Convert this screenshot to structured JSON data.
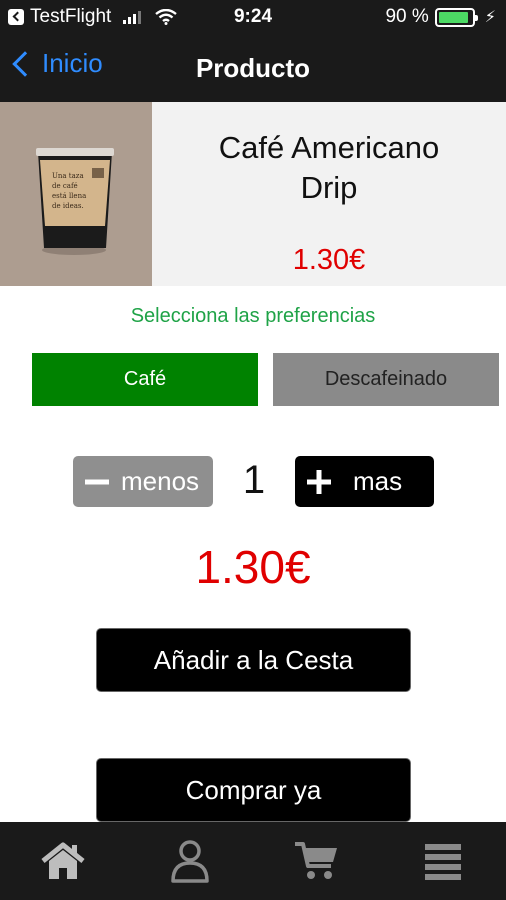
{
  "status_bar": {
    "app_name": "TestFlight",
    "time": "9:24",
    "battery_text": "90 %",
    "battery_level": 0.9,
    "battery_color": "#4cd964"
  },
  "nav": {
    "back_label": "Inicio",
    "title": "Producto"
  },
  "product": {
    "name_line1": "Café Americano",
    "name_line2": "Drip",
    "price": "1.30€",
    "image_icon": "coffee-cup-icon",
    "image_text": [
      "Una taza",
      "de café",
      "está llena",
      "de ideas."
    ]
  },
  "preferences": {
    "label": "Selecciona las preferencias",
    "options": [
      {
        "label": "Café",
        "selected": true
      },
      {
        "label": "Descafeinado",
        "selected": false
      }
    ]
  },
  "quantity": {
    "minus_label": "menos",
    "plus_label": "mas",
    "value": "1"
  },
  "total": "1.30€",
  "actions": {
    "add_to_cart": "Añadir a la Cesta",
    "buy_now": "Comprar ya"
  },
  "tabs": [
    {
      "icon": "home-icon"
    },
    {
      "icon": "user-icon"
    },
    {
      "icon": "cart-icon"
    },
    {
      "icon": "menu-icon"
    }
  ],
  "colors": {
    "accent_green": "#008200",
    "price_red": "#e00000",
    "link_blue": "#2f8cff"
  }
}
